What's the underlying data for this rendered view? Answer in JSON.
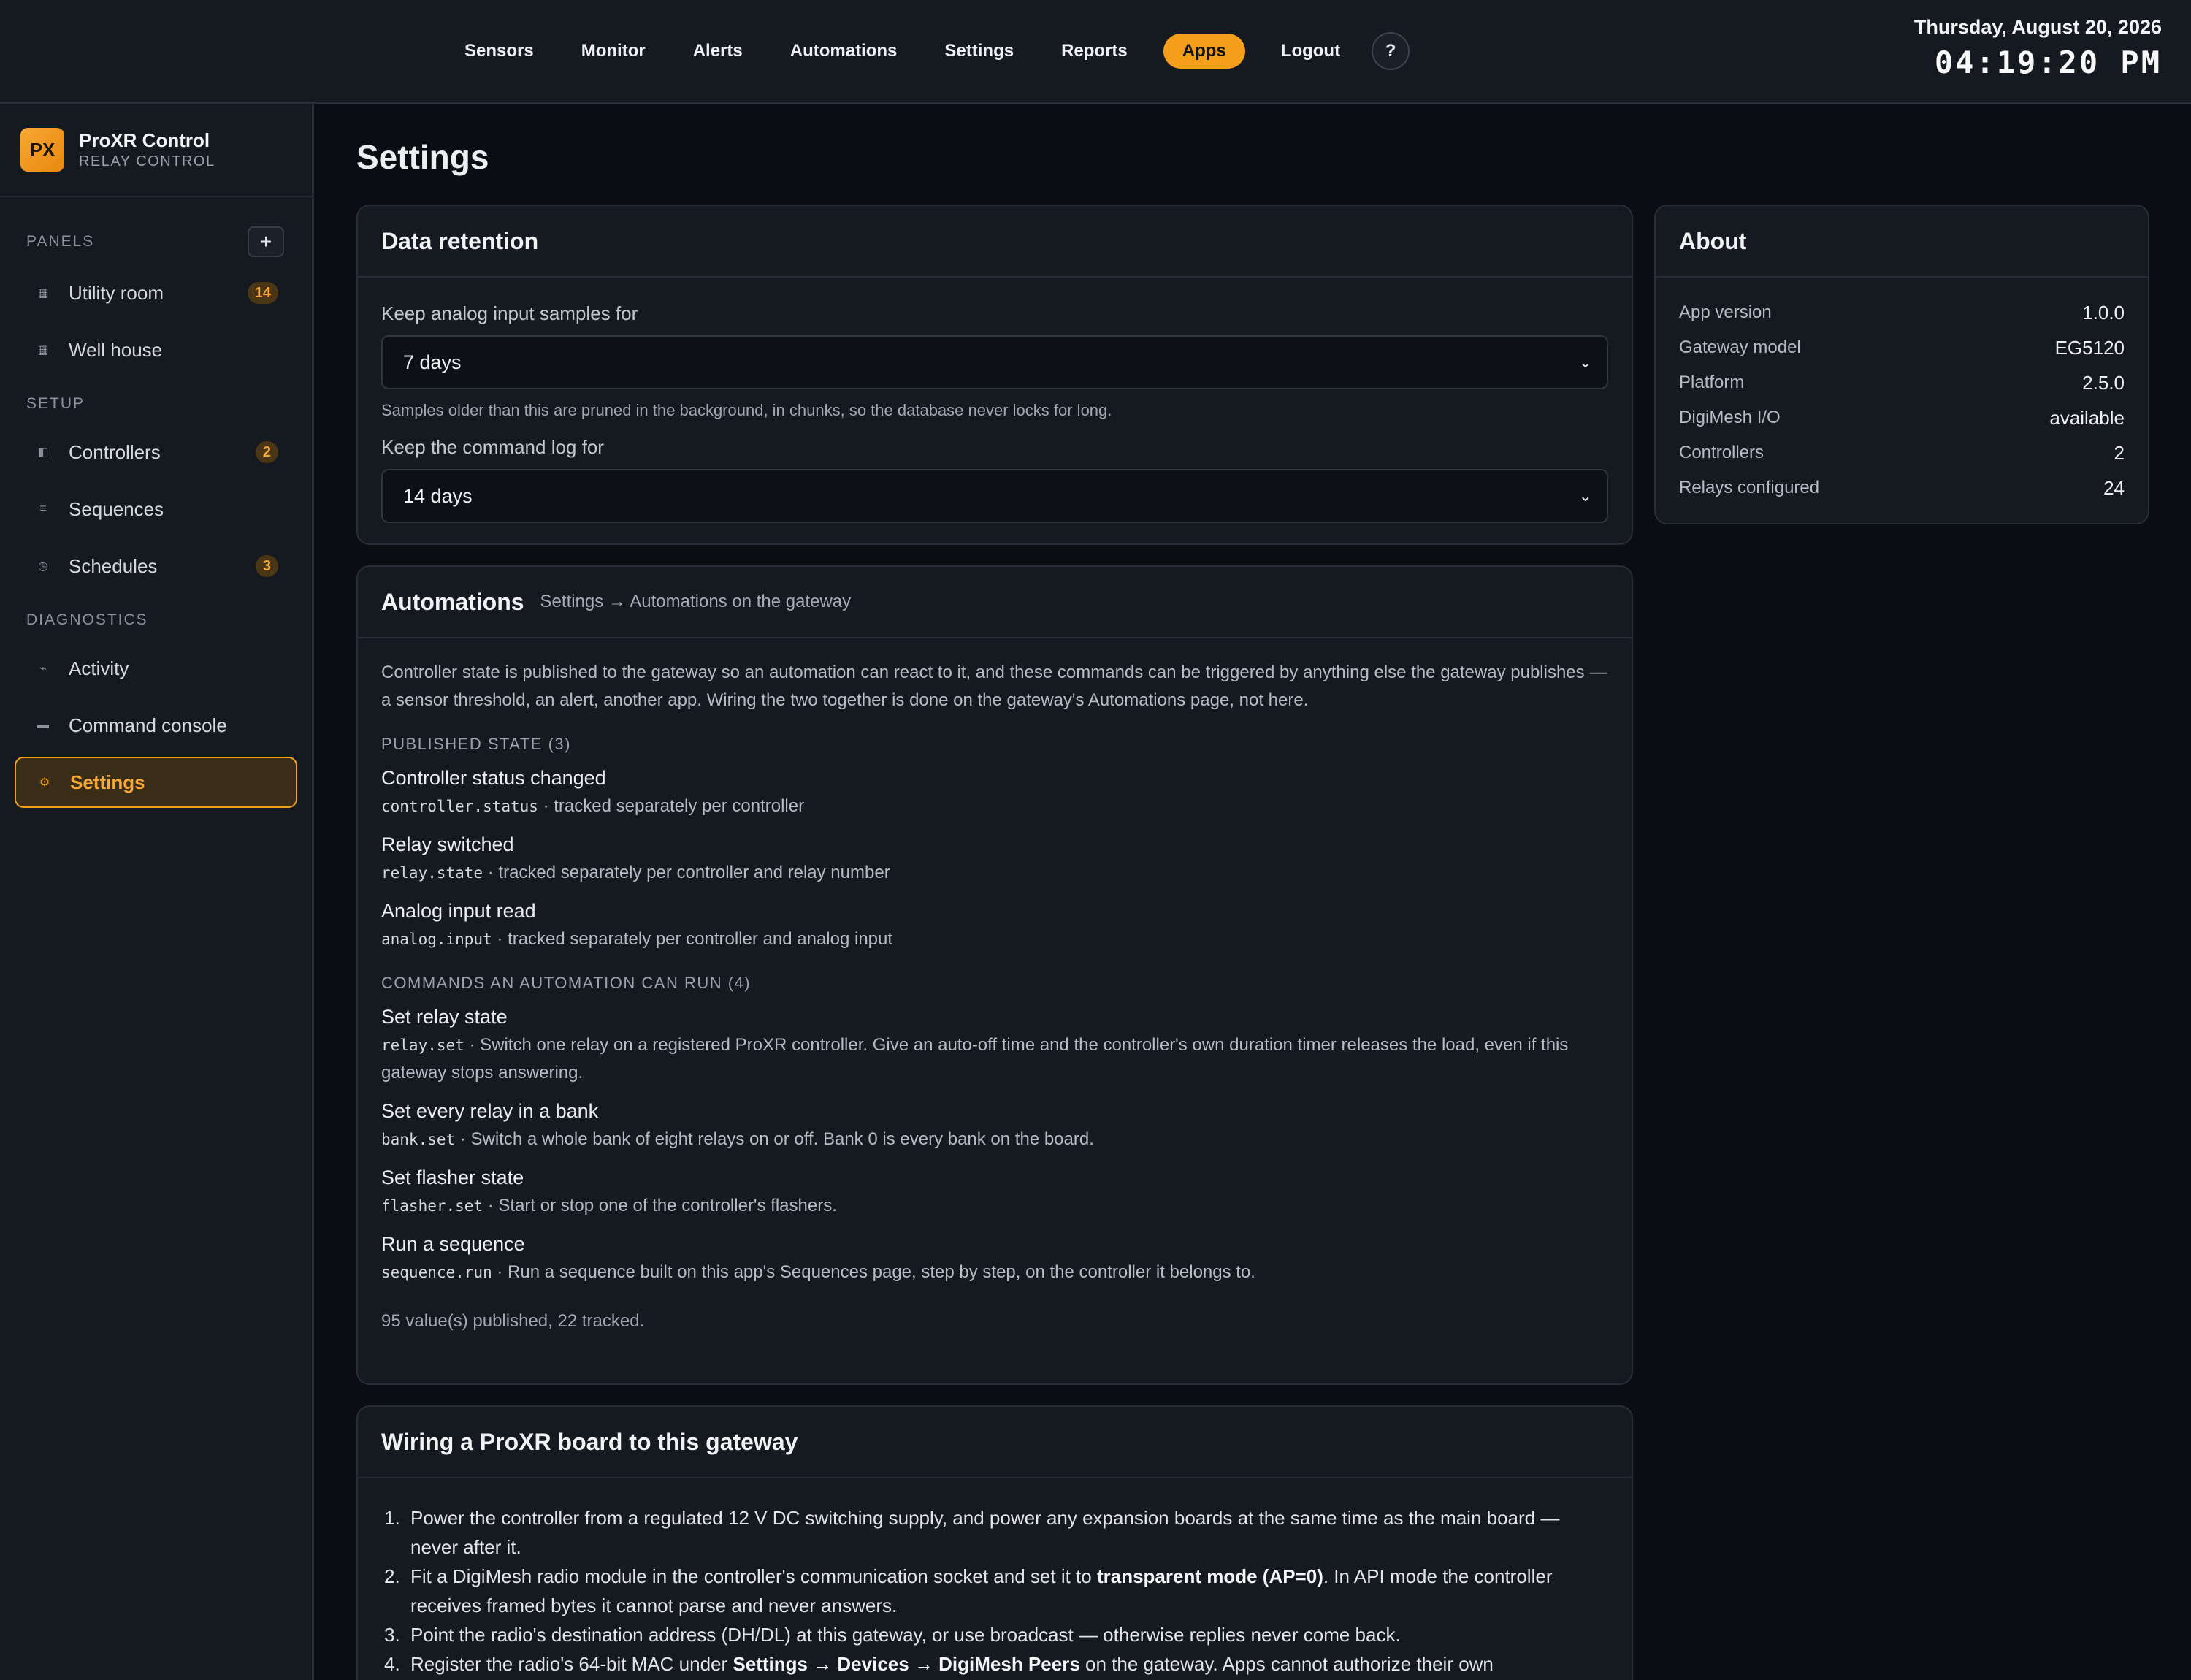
{
  "topbar": {
    "nav": [
      "Sensors",
      "Monitor",
      "Alerts",
      "Automations",
      "Settings",
      "Reports",
      "Apps",
      "Logout"
    ],
    "active_nav": "Apps",
    "help_label": "?",
    "date": "Thursday, August 20, 2026",
    "time": "04:19:20 PM"
  },
  "brand": {
    "logo": "PX",
    "name": "ProXR Control",
    "subtitle": "RELAY CONTROL"
  },
  "sidebar": {
    "panels_label": "PANELS",
    "add_label": "+",
    "panels": [
      {
        "label": "Utility room",
        "badge": "14",
        "icon": "grid-icon"
      },
      {
        "label": "Well house",
        "badge": "",
        "icon": "grid-icon"
      }
    ],
    "setup_label": "SETUP",
    "setup": [
      {
        "label": "Controllers",
        "badge": "2",
        "icon": "controller-icon"
      },
      {
        "label": "Sequences",
        "badge": "",
        "icon": "list-icon"
      },
      {
        "label": "Schedules",
        "badge": "3",
        "icon": "clock-icon"
      }
    ],
    "diagnostics_label": "DIAGNOSTICS",
    "diagnostics": [
      {
        "label": "Activity",
        "badge": "",
        "icon": "activity-icon"
      },
      {
        "label": "Command console",
        "badge": "",
        "icon": "console-icon"
      },
      {
        "label": "Settings",
        "badge": "",
        "icon": "gear-icon",
        "active": true
      }
    ]
  },
  "page": {
    "title": "Settings"
  },
  "retention": {
    "title": "Data retention",
    "analog_label": "Keep analog input samples for",
    "analog_value": "7 days",
    "analog_hint": "Samples older than this are pruned in the background, in chunks, so the database never locks for long.",
    "log_label": "Keep the command log for",
    "log_value": "14 days"
  },
  "automations": {
    "title": "Automations",
    "subtitle": "Settings → Automations on the gateway",
    "intro": "Controller state is published to the gateway so an automation can react to it, and these commands can be triggered by anything else the gateway publishes — a sensor threshold, an alert, another app. Wiring the two together is done on the gateway's Automations page, not here.",
    "published_label": "PUBLISHED STATE (3)",
    "published": [
      {
        "title": "Controller status changed",
        "code": "controller.status",
        "desc": " · tracked separately per controller"
      },
      {
        "title": "Relay switched",
        "code": "relay.state",
        "desc": " · tracked separately per controller and relay number"
      },
      {
        "title": "Analog input read",
        "code": "analog.input",
        "desc": " · tracked separately per controller and analog input"
      }
    ],
    "commands_label": "COMMANDS AN AUTOMATION CAN RUN (4)",
    "commands": [
      {
        "title": "Set relay state",
        "code": "relay.set",
        "desc": " · Switch one relay on a registered ProXR controller. Give an auto-off time and the controller's own duration timer releases the load, even if this gateway stops answering."
      },
      {
        "title": "Set every relay in a bank",
        "code": "bank.set",
        "desc": " · Switch a whole bank of eight relays on or off. Bank 0 is every bank on the board."
      },
      {
        "title": "Set flasher state",
        "code": "flasher.set",
        "desc": " · Start or stop one of the controller's flashers."
      },
      {
        "title": "Run a sequence",
        "code": "sequence.run",
        "desc": " · Run a sequence built on this app's Sequences page, step by step, on the controller it belongs to."
      }
    ],
    "summary": "95 value(s) published, 22 tracked."
  },
  "wiring": {
    "title": "Wiring a ProXR board to this gateway",
    "steps": [
      {
        "n": "1.",
        "pre": "Power the controller from a regulated 12 V DC switching supply, and power any expansion boards at the same time as the main board — never after it.",
        "bold": "",
        "post": ""
      },
      {
        "n": "2.",
        "pre": "Fit a DigiMesh radio module in the controller's communication socket and set it to ",
        "bold": "transparent mode (AP=0)",
        "post": ". In API mode the controller receives framed bytes it cannot parse and never answers."
      },
      {
        "n": "3.",
        "pre": "Point the radio's destination address (DH/DL) at this gateway, or use broadcast — otherwise replies never come back.",
        "bold": "",
        "post": ""
      },
      {
        "n": "4.",
        "pre": "Register the radio's 64-bit MAC under ",
        "bold": "Settings → Devices → DigiMesh Peers",
        "post": " on the gateway. Apps cannot authorize their own"
      }
    ]
  },
  "about": {
    "title": "About",
    "rows": [
      {
        "k": "App version",
        "v": "1.0.0"
      },
      {
        "k": "Gateway model",
        "v": "EG5120"
      },
      {
        "k": "Platform",
        "v": "2.5.0"
      },
      {
        "k": "DigiMesh I/O",
        "v": "available"
      },
      {
        "k": "Controllers",
        "v": "2"
      },
      {
        "k": "Relays configured",
        "v": "24"
      }
    ]
  },
  "colors": {
    "accent": "#f59e1c",
    "background": "#0a0d11",
    "panel": "#151a21"
  }
}
